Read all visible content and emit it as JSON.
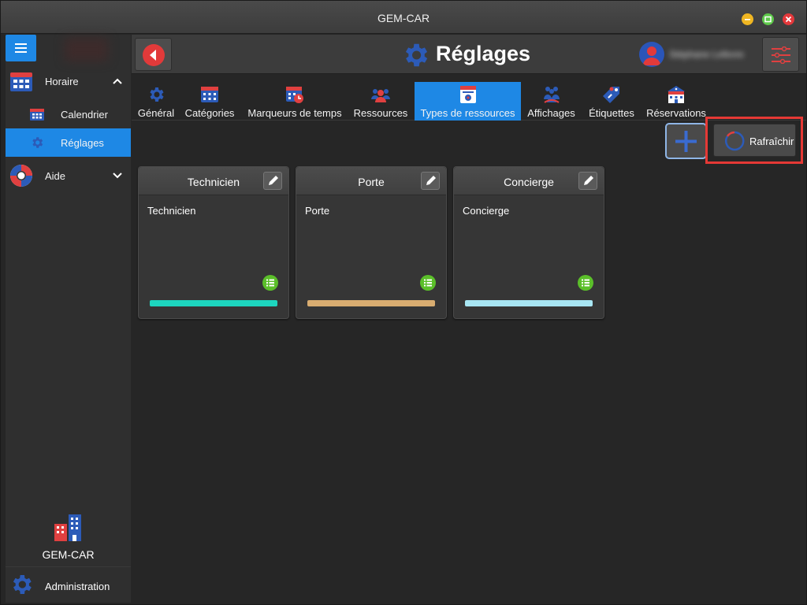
{
  "window": {
    "title": "GEM-CAR"
  },
  "sidebar": {
    "groups": [
      {
        "label": "Horaire",
        "expanded": true
      },
      {
        "label": "Aide",
        "expanded": false
      }
    ],
    "items": [
      {
        "label": "Calendrier",
        "active": false
      },
      {
        "label": "Réglages",
        "active": true
      }
    ],
    "brand": {
      "label": "GEM-CAR"
    },
    "admin": {
      "label": "Administration"
    }
  },
  "header": {
    "title": "Réglages",
    "user_name": "Stéphane Lefevre"
  },
  "tabs": [
    {
      "label": "Général",
      "icon": "gear-icon",
      "active": false
    },
    {
      "label": "Catégories",
      "icon": "calendar-grid-icon",
      "active": false
    },
    {
      "label": "Marqueurs de temps",
      "icon": "calendar-clock-icon",
      "active": false
    },
    {
      "label": "Ressources",
      "icon": "people-group-icon",
      "active": false
    },
    {
      "label": "Types de ressources",
      "icon": "resource-card-icon",
      "active": true
    },
    {
      "label": "Affichages",
      "icon": "display-people-icon",
      "active": false
    },
    {
      "label": "Étiquettes",
      "icon": "tag-icon",
      "active": false
    },
    {
      "label": "Réservations",
      "icon": "building-reservation-icon",
      "active": false
    }
  ],
  "toolbar": {
    "add_icon": "plus-icon",
    "refresh_label": "Rafraîchir"
  },
  "cards": [
    {
      "title": "Technicien",
      "description": "Technicien",
      "color": "#1dd6bf"
    },
    {
      "title": "Porte",
      "description": "Porte",
      "color": "#d9ad71"
    },
    {
      "title": "Concierge",
      "description": "Concierge",
      "color": "#a8e6f3"
    }
  ],
  "colors": {
    "accent": "#1e88e5",
    "danger": "#e23a3a",
    "success": "#5bbf2a",
    "highlight_border": "#e53935"
  }
}
